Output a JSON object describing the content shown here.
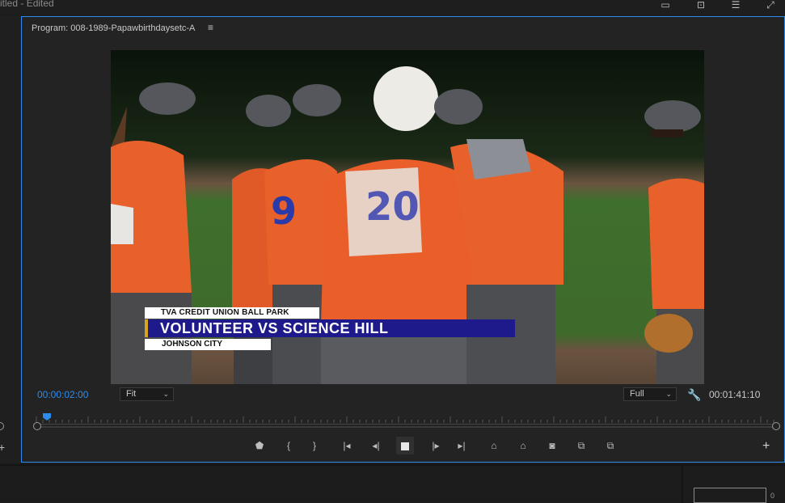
{
  "app": {
    "title": "itled",
    "edited": "- Edited"
  },
  "top_icons": [
    "export-frame-icon",
    "maximize-panel-icon",
    "workspace-menu-icon",
    "expand-icon"
  ],
  "monitor": {
    "title": "Program: 008-1989-Papawbirthdaysetc-A",
    "menu_glyph": "≡",
    "current_timecode": "00:00:02:00",
    "duration_timecode": "00:01:41:10",
    "zoom_select": "Fit",
    "resolution_select": "Full"
  },
  "video": {
    "lower_third": {
      "venue": "TVA CREDIT UNION BALL PARK",
      "headline": "VOLUNTEER VS SCIENCE HILL",
      "location": "JOHNSON CITY"
    }
  },
  "transport": [
    {
      "name": "add-marker-button",
      "glyph": "⬟"
    },
    {
      "name": "mark-in-button",
      "glyph": "{"
    },
    {
      "name": "mark-out-button",
      "glyph": "}"
    },
    {
      "name": "go-to-in-button",
      "glyph": "|◂"
    },
    {
      "name": "step-back-button",
      "glyph": "◂|"
    },
    {
      "name": "stop-button",
      "glyph": ""
    },
    {
      "name": "step-forward-button",
      "glyph": "|▸"
    },
    {
      "name": "go-to-out-button",
      "glyph": "▸|"
    },
    {
      "name": "lift-button",
      "glyph": "⌂"
    },
    {
      "name": "extract-button",
      "glyph": "⌂"
    },
    {
      "name": "export-frame-button",
      "glyph": "◙"
    },
    {
      "name": "comparison-view-button",
      "glyph": "⧉"
    },
    {
      "name": "proxy-toggle-button",
      "glyph": "⧉"
    }
  ],
  "add_button_glyph": "+",
  "meter_label": "0",
  "colors": {
    "accent": "#2d8ceb",
    "panel_bg": "#232323",
    "lower_third_blue": "#1f1a8c",
    "lower_third_gold": "#d9a520"
  }
}
